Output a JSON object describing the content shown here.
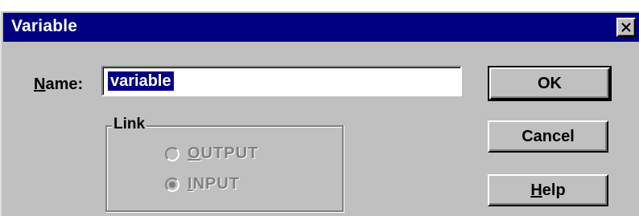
{
  "window": {
    "title": "Variable"
  },
  "name_field": {
    "label_mnemonic": "N",
    "label_rest": "ame:",
    "value": "variable"
  },
  "link_group": {
    "title": "Link",
    "options": [
      {
        "mnemonic": "O",
        "rest": "UTPUT",
        "checked": false,
        "enabled": false
      },
      {
        "mnemonic": "I",
        "rest": "NPUT",
        "checked": true,
        "enabled": false
      }
    ]
  },
  "buttons": {
    "ok": "OK",
    "cancel": "Cancel",
    "help_mnemonic": "H",
    "help_rest": "elp"
  },
  "icons": {
    "close": "close-icon"
  },
  "colors": {
    "titlebar": "#000080",
    "face": "#c0c0c0",
    "selection": "#000080"
  }
}
